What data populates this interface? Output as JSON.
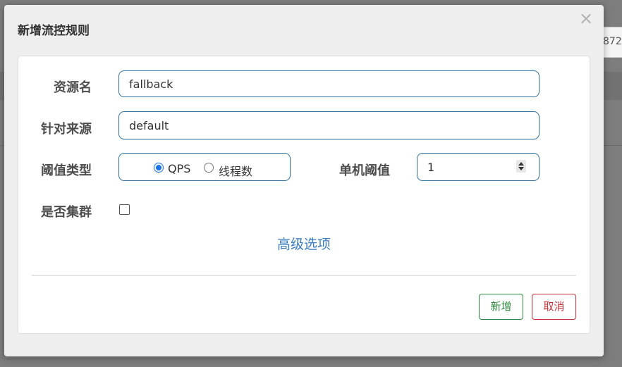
{
  "background": {
    "cell_text": "872"
  },
  "dialog": {
    "title": "新增流控规则",
    "close_glyph": "×"
  },
  "form": {
    "resource_name": {
      "label": "资源名",
      "value": "fallback"
    },
    "limit_app": {
      "label": "针对来源",
      "value": "default"
    },
    "threshold_type": {
      "label": "阈值类型",
      "options": [
        {
          "label": "QPS",
          "selected": true
        },
        {
          "label": "线程数",
          "selected": false
        }
      ]
    },
    "single_threshold": {
      "label": "单机阈值",
      "value": "1"
    },
    "cluster_mode": {
      "label": "是否集群",
      "checked": false
    },
    "advanced_link": "高级选项"
  },
  "buttons": {
    "add_label": "新增",
    "cancel_label": "取消"
  },
  "colors": {
    "input_border": "#2c6e9f",
    "link": "#3a7cc0",
    "add_button": "#2e8b3e",
    "cancel_button": "#c9303a"
  }
}
